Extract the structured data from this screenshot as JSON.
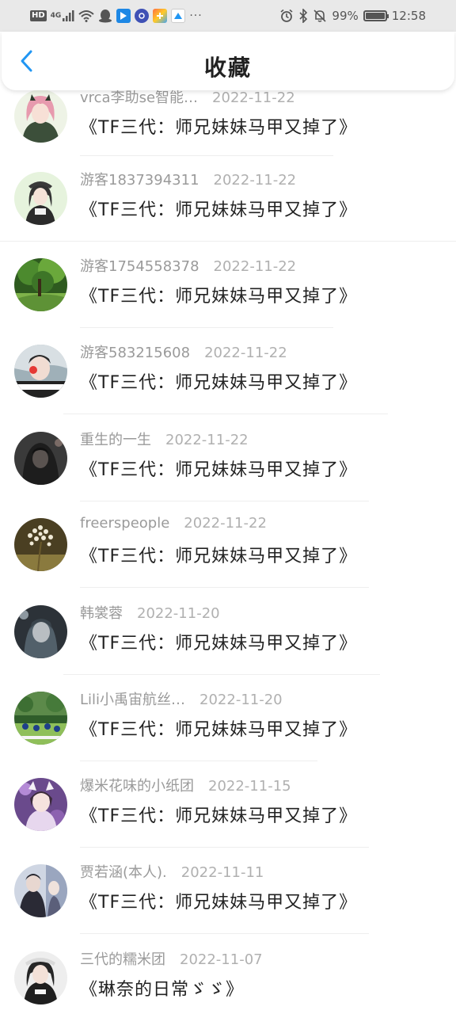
{
  "status_bar": {
    "hd": "HD",
    "network": "4G",
    "more": "···",
    "battery_pct": "99%",
    "battery_level": 0.99,
    "time": "12:58",
    "app_icons": [
      "qq-penguin-icon",
      "shield-app-icon",
      "music-app-icon",
      "colorful-app-icon",
      "mail-app-icon"
    ]
  },
  "header": {
    "title": "收藏",
    "back_icon": "chevron-left-icon",
    "accent": "#2196f3"
  },
  "favorites": [
    {
      "user": "vrca李助se智能…",
      "date": "2022-11-22",
      "book": "《TF三代：师兄妹妹马甲又掉了》"
    },
    {
      "user": "游客1837394311",
      "date": "2022-11-22",
      "book": "《TF三代：师兄妹妹马甲又掉了》"
    },
    {
      "user": "游客1754558378",
      "date": "2022-11-22",
      "book": "《TF三代：师兄妹妹马甲又掉了》"
    },
    {
      "user": "游客583215608",
      "date": "2022-11-22",
      "book": "《TF三代：师兄妹妹马甲又掉了》"
    },
    {
      "user": "重生的一生",
      "date": "2022-11-22",
      "book": "《TF三代：师兄妹妹马甲又掉了》"
    },
    {
      "user": "freerspeople",
      "date": "2022-11-22",
      "book": "《TF三代：师兄妹妹马甲又掉了》"
    },
    {
      "user": "韩裳蓉",
      "date": "2022-11-20",
      "book": "《TF三代：师兄妹妹马甲又掉了》"
    },
    {
      "user": "Lili小禹宙航丝…",
      "date": "2022-11-20",
      "book": "《TF三代：师兄妹妹马甲又掉了》"
    },
    {
      "user": "爆米花味的小纸团",
      "date": "2022-11-15",
      "book": "《TF三代：师兄妹妹马甲又掉了》"
    },
    {
      "user": "贾若涵(本人).",
      "date": "2022-11-11",
      "book": "《TF三代：师兄妹妹马甲又掉了》"
    },
    {
      "user": "三代的糯米团",
      "date": "2022-11-07",
      "book": "《琳奈的日常ゞゞ》"
    }
  ]
}
